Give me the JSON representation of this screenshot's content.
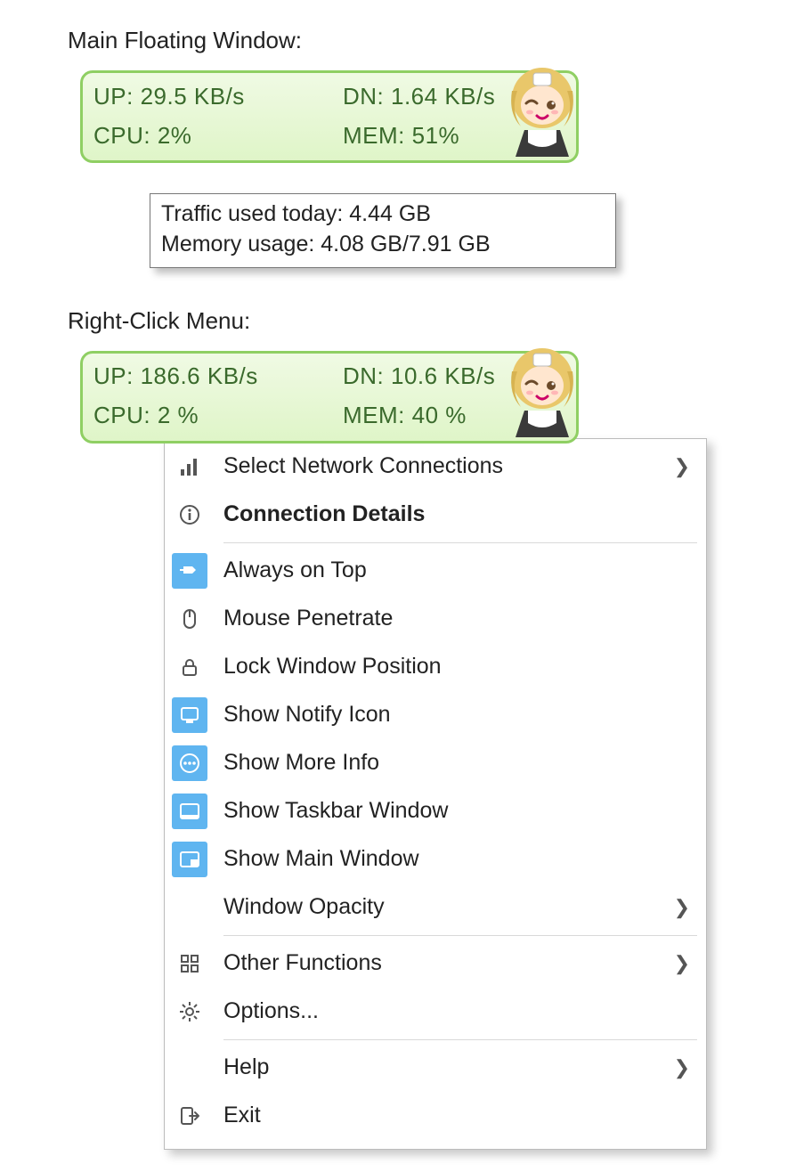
{
  "headings": {
    "floating": "Main Floating Window:",
    "menu": "Right-Click Menu:"
  },
  "widget1": {
    "up": "UP: 29.5 KB/s",
    "dn": "DN: 1.64 KB/s",
    "cpu": "CPU: 2%",
    "mem": "MEM: 51%"
  },
  "tooltip": {
    "line1": "Traffic used today: 4.44 GB",
    "line2": "Memory usage: 4.08 GB/7.91 GB"
  },
  "widget2": {
    "up": "UP: 186.6 KB/s",
    "dn": "DN: 10.6 KB/s",
    "cpu": "CPU: 2 %",
    "mem": "MEM: 40 %"
  },
  "menu": {
    "select_net": "Select Network Connections",
    "conn_details": "Connection Details",
    "always_on_top": "Always on Top",
    "mouse_penetrate": "Mouse Penetrate",
    "lock_window": "Lock Window Position",
    "show_notify": "Show Notify Icon",
    "show_more": "Show More Info",
    "show_taskbar": "Show Taskbar Window",
    "show_main": "Show Main Window",
    "opacity": "Window Opacity",
    "other": "Other Functions",
    "options": "Options...",
    "help": "Help",
    "exit": "Exit"
  },
  "colors": {
    "widget_border": "#8fcf63",
    "widget_text": "#3a6a2c",
    "menu_highlight": "#5fb5f0"
  }
}
